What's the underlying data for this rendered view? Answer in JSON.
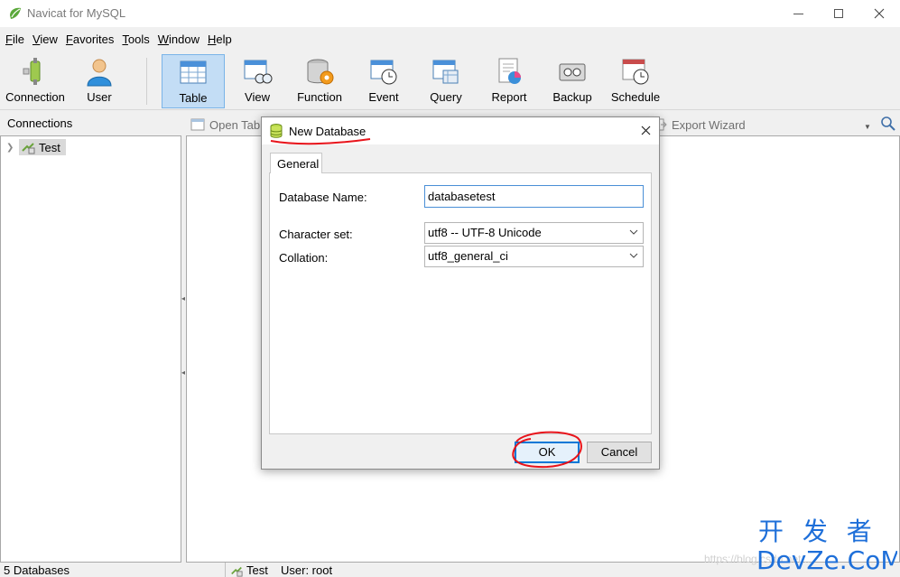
{
  "window": {
    "title": "Navicat for MySQL",
    "controls": [
      "minimize",
      "maximize",
      "close"
    ]
  },
  "menu": [
    {
      "label": "File",
      "mnemonic": "F",
      "rest": "ile"
    },
    {
      "label": "View",
      "mnemonic": "V",
      "rest": "iew"
    },
    {
      "label": "Favorites",
      "mnemonic": "F",
      "rest": "avorites"
    },
    {
      "label": "Tools",
      "mnemonic": "T",
      "rest": "ools"
    },
    {
      "label": "Window",
      "mnemonic": "W",
      "rest": "indow"
    },
    {
      "label": "Help",
      "mnemonic": "H",
      "rest": "elp"
    }
  ],
  "toolbar": {
    "connection": "Connection",
    "user": "User",
    "table": "Table",
    "view": "View",
    "function": "Function",
    "event": "Event",
    "query": "Query",
    "report": "Report",
    "backup": "Backup",
    "schedule": "Schedule",
    "active": "Table"
  },
  "connections": {
    "header": "Connections",
    "items": [
      {
        "label": "Test",
        "icon": "mysql-connection-icon"
      }
    ]
  },
  "object_toolbar": {
    "open_table": "Open Tab",
    "export_wizard": "Export Wizard"
  },
  "status": {
    "databases": "5 Databases",
    "connection": "Test",
    "user": "User: root"
  },
  "dialog": {
    "title": "New Database",
    "tab": "General",
    "database_name_label": "Database Name:",
    "database_name_value": "databasetest",
    "charset_label": "Character set:",
    "charset_value": "utf8 -- UTF-8 Unicode",
    "collation_label": "Collation:",
    "collation_value": "utf8_general_ci",
    "ok": "OK",
    "cancel": "Cancel"
  },
  "colors": {
    "accent": "#0078d7",
    "active_tool": "#c3ddf5",
    "annotation": "#e8141b"
  },
  "watermark": {
    "top": "开 发 者",
    "bottom": "DevZe.CoM",
    "faint": "https://blog.csdn.net/..."
  }
}
